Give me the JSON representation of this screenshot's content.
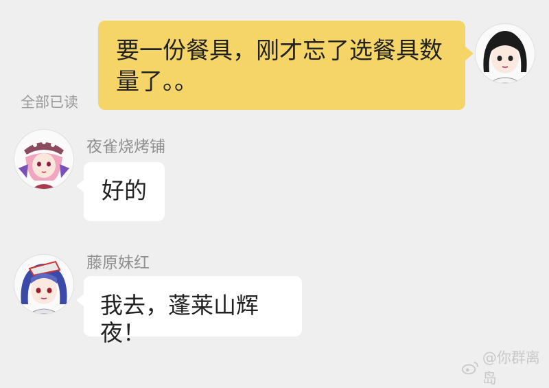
{
  "outgoing": {
    "text": "要一份餐具，刚才忘了选餐具数量了。。",
    "read_status": "全部已读"
  },
  "incoming": [
    {
      "sender": "夜雀烧烤铺",
      "text": "好的"
    },
    {
      "sender": "藤原妹红",
      "text": "我去，蓬莱山辉夜！"
    }
  ],
  "watermark": {
    "text": "@你群离岛"
  },
  "colors": {
    "background": "#efefef",
    "outgoing_bubble": "#f6d568",
    "incoming_bubble": "#ffffff",
    "meta_text": "#9a9a9a"
  }
}
